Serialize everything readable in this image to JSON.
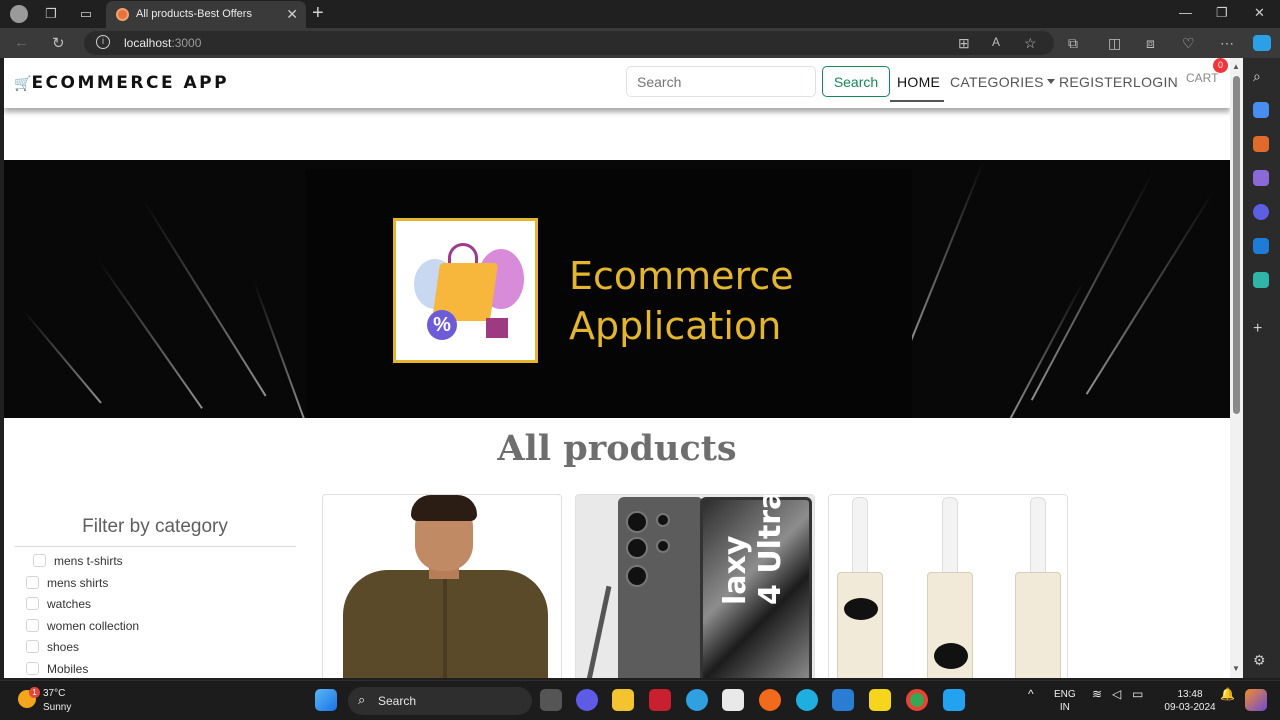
{
  "browser": {
    "tab_title": "All products-Best Offers",
    "url_host": "localhost",
    "url_port": ":3000"
  },
  "navbar": {
    "brand": "ECOMMERCE APP",
    "search_placeholder": "Search",
    "search_button": "Search",
    "links": {
      "home": "HOME",
      "categories": "CATEGORIES",
      "register": "REGISTER",
      "login": "LOGIN",
      "cart": "CART"
    },
    "cart_count": "0"
  },
  "banner": {
    "line1": "Ecommerce",
    "line2": "Application"
  },
  "main": {
    "heading": "All products",
    "filter_title": "Filter by category",
    "categories": [
      "mens t-shirts",
      "mens shirts",
      "watches",
      "women collection",
      "shoes",
      "Mobiles"
    ],
    "phone_label_line1": "laxy",
    "phone_label_line2": "4 Ultra"
  },
  "taskbar": {
    "temperature": "37°C",
    "condition": "Sunny",
    "weather_badge": "1",
    "search_label": "Search",
    "lang_line1": "ENG",
    "lang_line2": "IN",
    "time": "13:48",
    "date": "09-03-2024"
  },
  "colors": {
    "accent_green": "#198754",
    "banner_gold": "#e3b62d",
    "badge_red": "#f0353b"
  }
}
